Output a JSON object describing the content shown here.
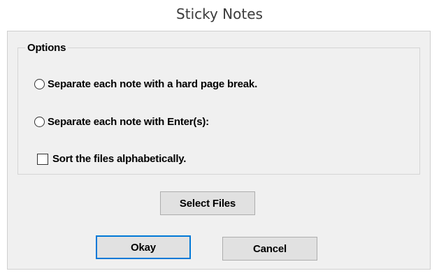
{
  "window": {
    "title": "Sticky Notes"
  },
  "options_group": {
    "legend": "Options",
    "radio_hard_break_label": "Separate each note with a hard page break.",
    "radio_enter_label": "Separate each note with Enter(s):",
    "checkbox_sort_label": "Sort the files alphabetically."
  },
  "buttons": {
    "select_files": "Select Files",
    "okay": "Okay",
    "cancel": "Cancel"
  },
  "state": {
    "radio_hard_break_selected": false,
    "radio_enter_selected": false,
    "checkbox_sort_checked": false
  },
  "colors": {
    "dialog_background": "#f0f0f0",
    "default_button_border": "#0078d7",
    "button_face": "#e1e1e1"
  }
}
